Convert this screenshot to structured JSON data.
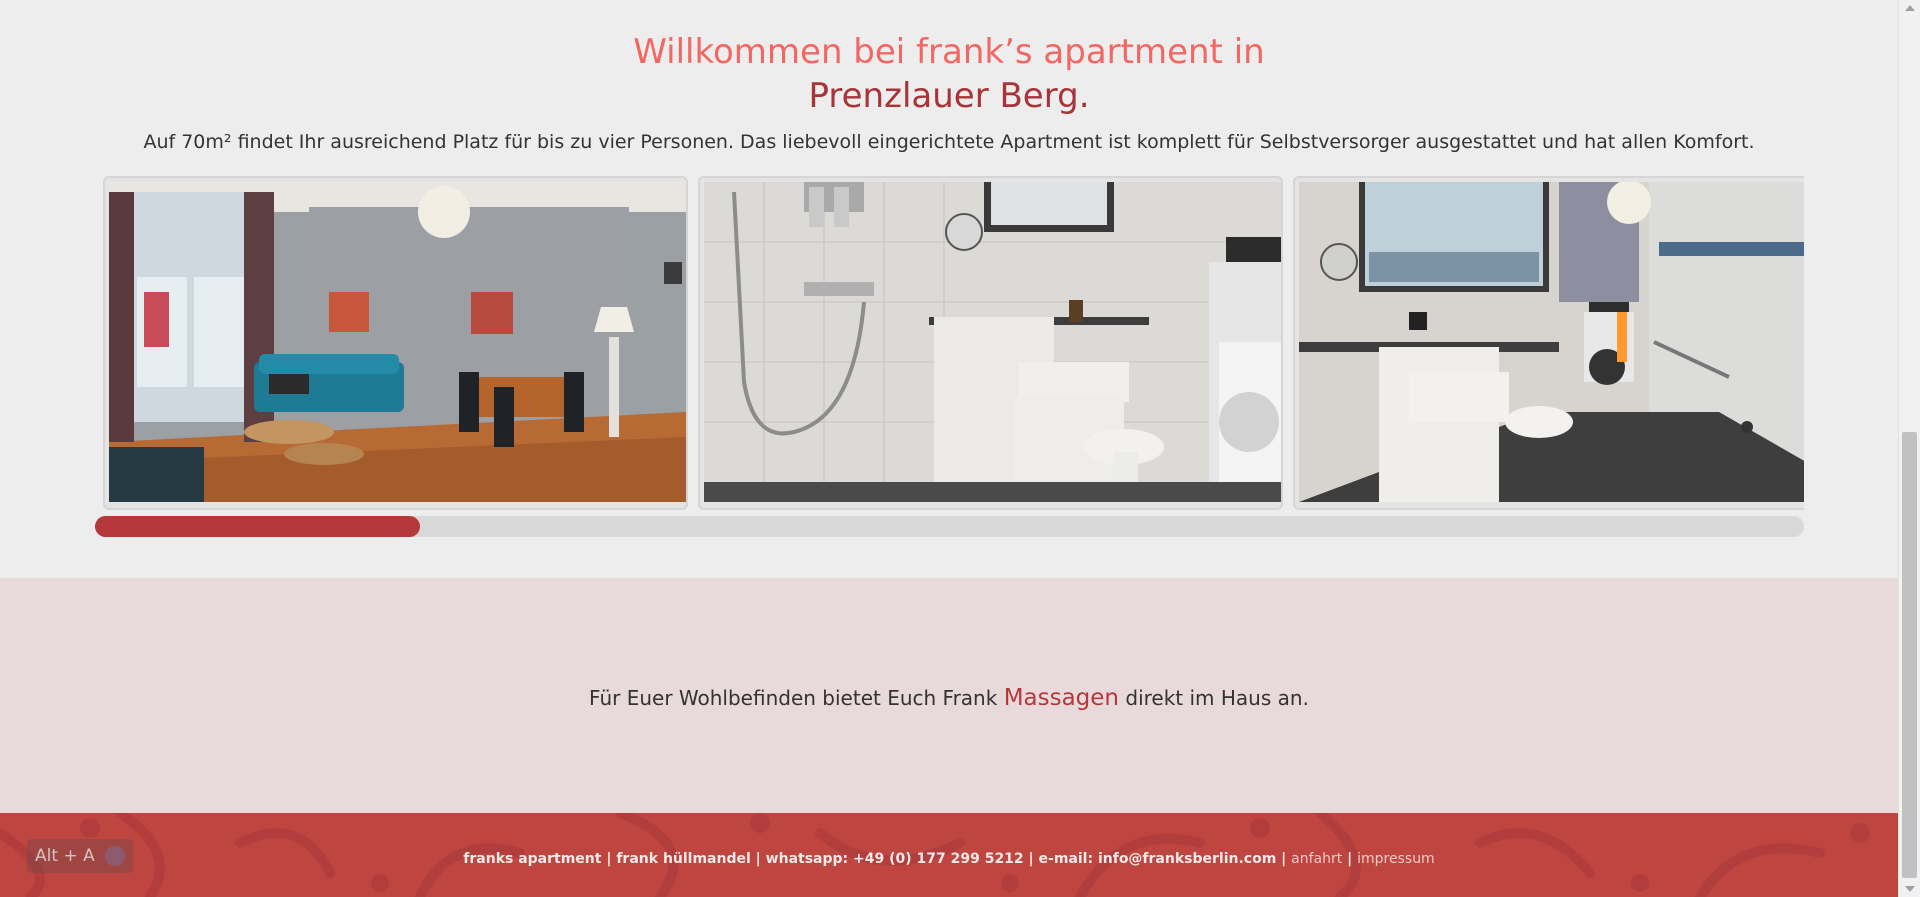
{
  "header": {
    "title_line1": "Willkommen bei frank’s apartment in",
    "title_line2": "Prenzlauer Berg.",
    "intro": "Auf 70m² findet Ihr ausreichend Platz für bis zu vier Personen. Das liebevoll eingerichtete Apartment ist komplett für Selbstversorger ausgestattet und hat allen Komfort."
  },
  "gallery": {
    "slides": [
      {
        "icon": "living-room-photo"
      },
      {
        "icon": "shower-bathroom-photo"
      },
      {
        "icon": "bathroom-corridor-photo"
      }
    ],
    "scroll_progress": 0.19
  },
  "massage": {
    "text_before": "Für Euer Wohlbefinden bietet Euch Frank ",
    "link_label": "Massagen",
    "text_after": " direkt im Haus an."
  },
  "footer": {
    "company": "franks apartment",
    "owner": "frank hüllmandel",
    "whatsapp": "whatsapp: +49 (0) 177 299 5212",
    "email": "e-mail: info@franksberlin.com",
    "link_anfahrt": "anfahrt",
    "link_impressum": "impressum",
    "separator": " | "
  },
  "shortcut_badge": {
    "label": "Alt + A"
  },
  "colors": {
    "title_light": "#f26762",
    "title_dark": "#a8343a",
    "accent": "#b5383b",
    "footer_bg": "#bf4640",
    "massage_bg": "#e8d9da"
  }
}
